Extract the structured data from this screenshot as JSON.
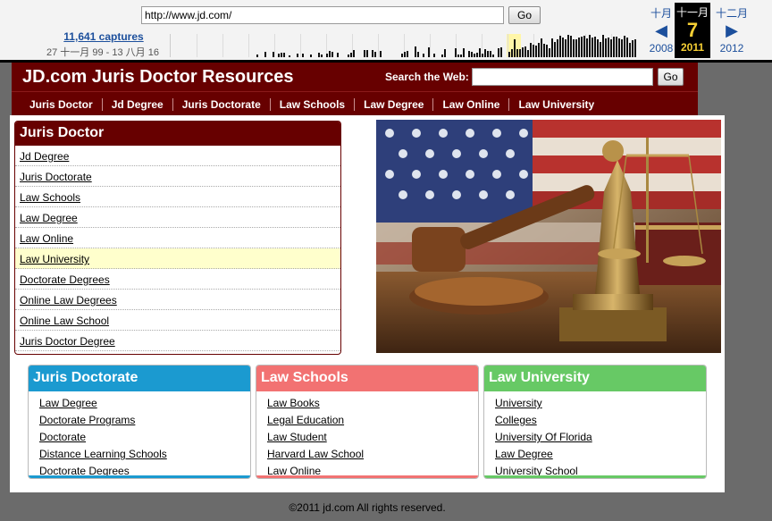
{
  "wayback": {
    "url": "http://www.jd.com/",
    "go_label": "Go",
    "captures": "11,641 captures",
    "date_range": "27 十一月 99 - 13 八月 16",
    "prev": {
      "month": "十月",
      "year": "2008"
    },
    "current": {
      "month": "十一月",
      "day": "7",
      "year": "2011"
    },
    "next": {
      "month": "十二月",
      "year": "2012"
    }
  },
  "header": {
    "title": "JD.com Juris Doctor Resources",
    "search_label": "Search the Web:",
    "search_value": "",
    "go_label": "Go"
  },
  "nav": {
    "items": [
      "Juris Doctor",
      "Jd Degree",
      "Juris Doctorate",
      "Law Schools",
      "Law Degree",
      "Law Online",
      "Law University"
    ]
  },
  "main_box": {
    "title": "Juris Doctor",
    "links": [
      "Jd Degree",
      "Juris Doctorate",
      "Law Schools",
      "Law Degree",
      "Law Online",
      "Law University",
      "Doctorate Degrees",
      "Online Law Degrees",
      "Online Law School",
      "Juris Doctor Degree"
    ],
    "highlighted_index": 5
  },
  "columns": [
    {
      "title": "Juris Doctorate",
      "color": "#1b9ad0",
      "links": [
        "Law Degree",
        "Doctorate Programs",
        "Doctorate",
        "Distance Learning Schools",
        "Doctorate Degrees"
      ]
    },
    {
      "title": "Law Schools",
      "color": "#f27272",
      "links": [
        "Law Books",
        "Legal Education",
        "Law Student",
        "Harvard Law School",
        "Law Online"
      ]
    },
    {
      "title": "Law University",
      "color": "#67c965",
      "links": [
        "University",
        "Colleges",
        "University Of Florida",
        "Law Degree",
        "University School"
      ]
    }
  ],
  "footer": {
    "text": "©2011 jd.com All rights reserved."
  },
  "colors": {
    "header_bg": "#670000",
    "page_bg": "#6b6b6b"
  }
}
